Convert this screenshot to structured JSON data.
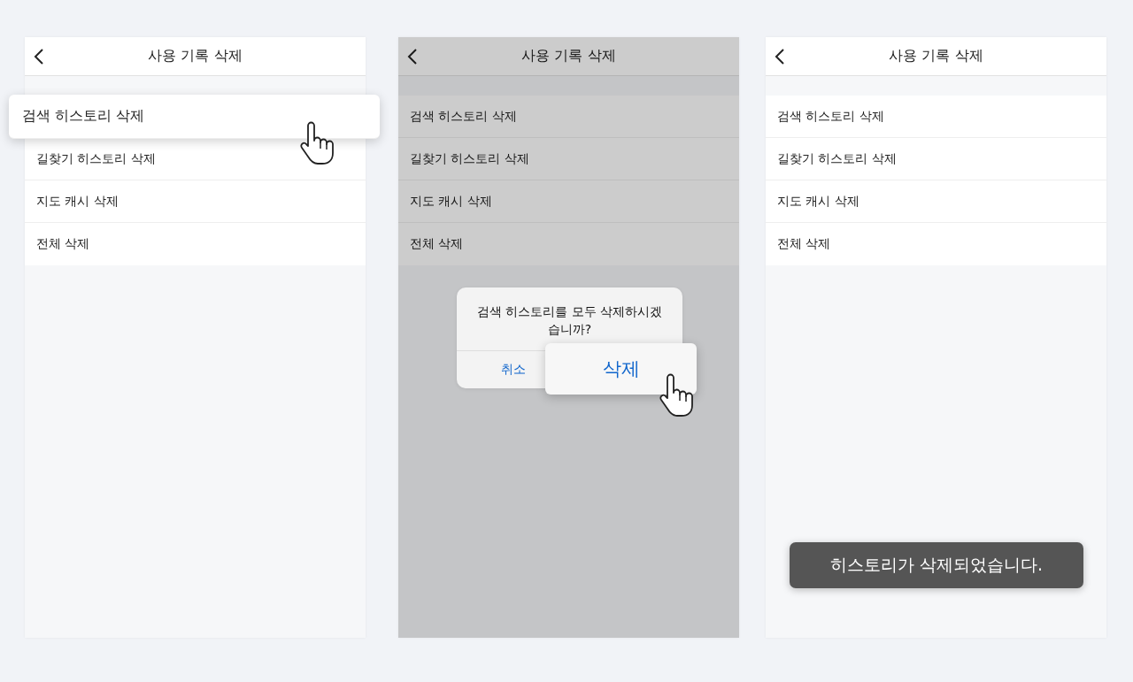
{
  "screens": [
    {
      "title": "사용 기록 삭제",
      "dimmed": false,
      "items": [
        {
          "label": "검색 히스토리 삭제",
          "selected": true
        },
        {
          "label": "길찾기 히스토리 삭제",
          "selected": false
        },
        {
          "label": "지도 캐시 삭제",
          "selected": false
        },
        {
          "label": "전체 삭제",
          "selected": false
        }
      ]
    },
    {
      "title": "사용 기록 삭제",
      "dimmed": true,
      "items": [
        {
          "label": "검색 히스토리 삭제",
          "selected": false
        },
        {
          "label": "길찾기 히스토리 삭제",
          "selected": false
        },
        {
          "label": "지도 캐시 삭제",
          "selected": false
        },
        {
          "label": "전체 삭제",
          "selected": false
        }
      ],
      "dialog": {
        "message": "검색 히스토리를 모두 삭제하시겠습니까?",
        "buttons": [
          {
            "label": "취소",
            "selected": false
          },
          {
            "label": "삭제",
            "selected": true
          }
        ]
      }
    },
    {
      "title": "사용 기록 삭제",
      "dimmed": false,
      "items": [
        {
          "label": "검색 히스토리 삭제",
          "selected": false
        },
        {
          "label": "길찾기 히스토리 삭제",
          "selected": false
        },
        {
          "label": "지도 캐시 삭제",
          "selected": false
        },
        {
          "label": "전체 삭제",
          "selected": false
        }
      ],
      "toast": "히스토리가 삭제되었습니다."
    }
  ]
}
